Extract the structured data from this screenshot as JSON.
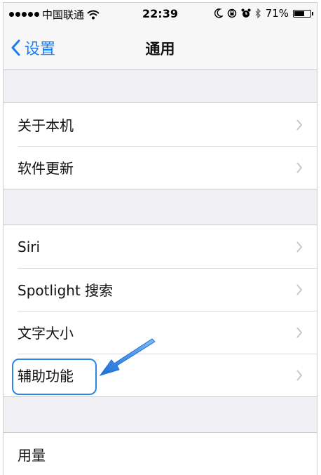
{
  "status_bar": {
    "carrier": "中国联通",
    "time": "22:39",
    "battery_text": "71%",
    "battery_level": 0.71
  },
  "nav": {
    "back_label": "设置",
    "title": "通用"
  },
  "groups": [
    {
      "items": [
        "关于本机",
        "软件更新"
      ]
    },
    {
      "items": [
        "Siri",
        "Spotlight 搜索",
        "文字大小",
        "辅助功能"
      ]
    },
    {
      "items": [
        "用量"
      ]
    }
  ],
  "annotation": {
    "highlighted_item": "辅助功能",
    "color": "#2b86e6"
  },
  "colors": {
    "accent": "#1c7cf4",
    "background": "#efeff4",
    "separator": "#c8c7cc"
  }
}
